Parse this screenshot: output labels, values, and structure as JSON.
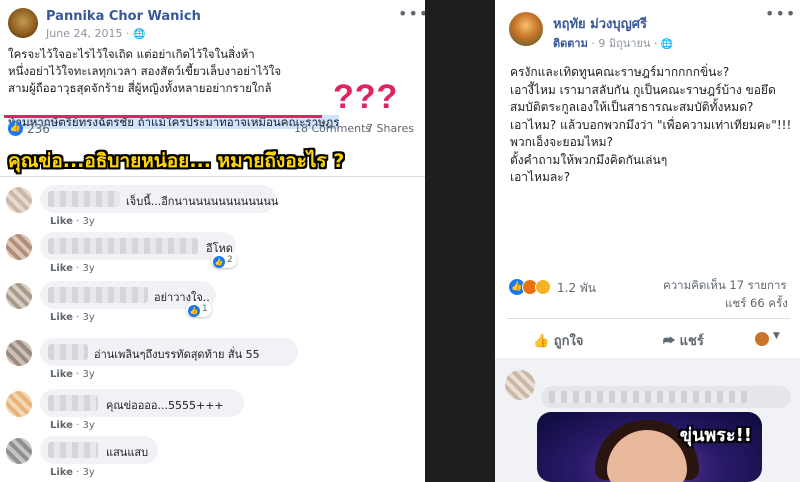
{
  "left_post": {
    "author": "Pannika Chor Wanich",
    "date": "June 24, 2015 ·",
    "lines": [
      "ใครจะไว้ใจอะไรไว้ใจเถิด แต่อย่าเกิดไว้ใจในสิ่งห้า",
      "หนึ่งอย่าไว้ใจทะเลทุกเวลา สองสัตว์เขี้ยวเล็บงาอย่าไว้ใจ",
      "สามผู้ถืออาวุธสุดจักร้าย สี่ผู้หญิงทั้งหลายอย่ากรายใกล้"
    ],
    "highlight_line": "ห้ามหากษัตริย์ทรงฉัตรชัย ถ้าแม้ใครประมาทอาจเหมือนคณะราษฎร",
    "question_marks": "???",
    "reaction_count": "236",
    "comments_count": "18 Comments",
    "shares_count": "7 Shares",
    "caption": "คุณข่อ...อธิบายหน่อย... หมายถึงอะไร ?",
    "comments": [
      {
        "text": "เจ็บนี้...อีกนานนนนนนนนนนนน",
        "like": "Like",
        "time": "3y",
        "reactions": ""
      },
      {
        "text": "อีโหด",
        "like": "Like",
        "time": "3y",
        "reactions": "2"
      },
      {
        "text": "อย่าวางใจ..",
        "like": "Like",
        "time": "3y",
        "reactions": "1"
      },
      {
        "text": "อ่านเพลินๆถึงบรรทัดสุดท้าย สั่น 55",
        "like": "Like",
        "time": "3y",
        "reactions": ""
      },
      {
        "text": "คุณข่ออออ...5555+++",
        "like": "Like",
        "time": "3y",
        "reactions": ""
      },
      {
        "text": "แสนแสบ",
        "like": "Like",
        "time": "3y",
        "reactions": ""
      }
    ]
  },
  "right_post": {
    "author": "หฤทัย ม่วงบุญศรี",
    "follow": "ติดตาม",
    "date": "· 9 มิถุนายน ·",
    "text": "ครงักและเทิดทูนคณะราษฎร์มากกกกขิ่นะ?\nเอางี้ไหม เรามาสลับกัน กูเป็นคณะราษฎร์บ้าง ขอยึดสมบัติตระกูลเองให้เป็นสาธารณะสมบัติทั้งหมด?\nเอาไหม? แล้วบอกพวกมึงว่า \"เพื่อความเท่าเทียมคะ\"!!!\nพวกเอ็งจะยอมไหม?\nตั้งคำถามให้พวกมึงคิดกันเล่นๆ\nเอาไหมละ?",
    "reaction_count": "1.2 พัน",
    "comment_count": "ความคิดเห็น 17 รายการ",
    "share_count": "แชร์ 66 ครั้ง",
    "like_label": "ถูกใจ",
    "share_label": "แชร์",
    "meme_text": "ขุ่นพระ!!"
  },
  "colors": {
    "accent": "#e0245e",
    "fb_blue": "#1877f2",
    "caption": "#ffd400"
  }
}
